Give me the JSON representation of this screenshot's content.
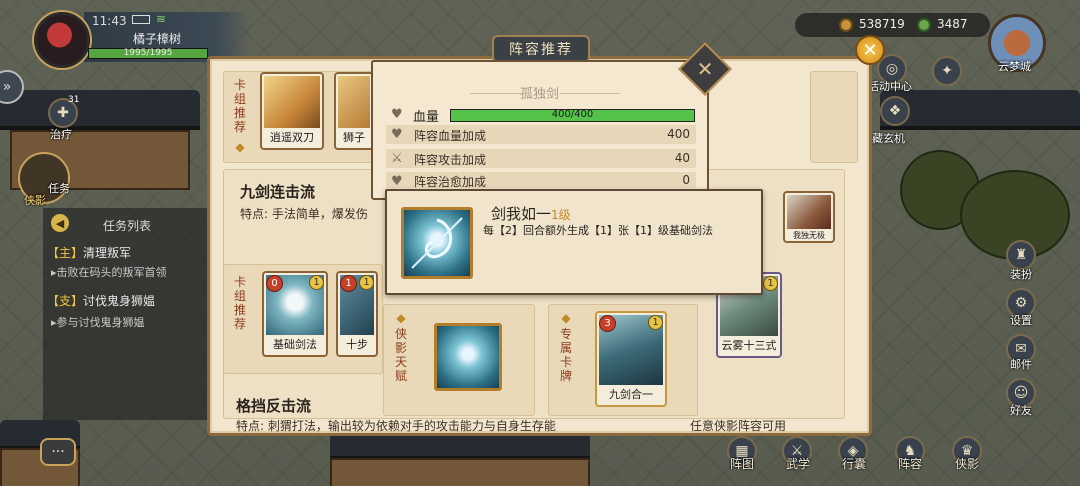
{
  "status": {
    "time": "11:43"
  },
  "player": {
    "name": "橘子樟树",
    "hp_text": "1995/1995",
    "hp_fraction": 1.0
  },
  "resources": {
    "silver": "538719",
    "jade": "3487"
  },
  "city": {
    "label": "云梦城"
  },
  "left_icons": {
    "heal_label": "治疗",
    "heal_count": "31",
    "task_label": "任务",
    "shadow_label": "侠影"
  },
  "tasks": {
    "header": "任务列表",
    "items": [
      {
        "tag": "【主】",
        "title": "清理叛军",
        "detail": "击败在码头的叛军首领"
      },
      {
        "tag": "【支】",
        "title": "讨伐鬼身狮媪",
        "detail": "参与讨伐鬼身狮媪"
      }
    ]
  },
  "right_menu": [
    "活动中心",
    "藏玄机",
    "装扮",
    "设置",
    "邮件",
    "好友"
  ],
  "bottom_menu": [
    "阵图",
    "武学",
    "行囊",
    "阵容",
    "侠影"
  ],
  "panel": {
    "title": "阵容推荐",
    "close_symbol": "✕",
    "section1": {
      "vertical": "卡组推荐",
      "cards": [
        {
          "name": "逍遥双刀"
        },
        {
          "name": "狮子"
        }
      ]
    },
    "section2": {
      "title": "九剑连击流",
      "desc": "特点: 手法简单，爆发伤",
      "vertical": "卡组推荐",
      "cards": [
        {
          "name": "基础剑法",
          "cost": "0",
          "level": "1"
        },
        {
          "name": "十步",
          "cost": "1",
          "level": "1"
        }
      ],
      "talent_vertical": "侠影天赋",
      "exclusive_vertical": "专属卡牌",
      "exclusive_card": {
        "name": "九剑合一",
        "cost": "3",
        "level": "1"
      },
      "right_cards": [
        {
          "name": "我独无极"
        },
        {
          "name": "云雾十三式",
          "level": "1"
        }
      ]
    },
    "section3": {
      "title": "格挡反击流",
      "desc": "特点: 刺猬打法，输出较为依赖对手的攻击能力与自身生存能",
      "extra": "任意侠影阵容可用"
    }
  },
  "stats": {
    "hero_name": "孤独剑",
    "close_symbol": "✕",
    "hp_label": "血量",
    "hp_text": "400/400",
    "hp_fraction": 1.0,
    "rows": [
      {
        "label": "阵容血量加成",
        "value": "400"
      },
      {
        "label": "阵容攻击加成",
        "value": "40"
      },
      {
        "label": "阵容治愈加成",
        "value": "0"
      }
    ]
  },
  "tooltip": {
    "name": "剑我如一",
    "level": "1级",
    "desc": "每【2】回合额外生成【1】张【1】级基础剑法"
  },
  "colors": {
    "hp_green": "#55c24a",
    "accent_gold": "#c08a26",
    "panel_bg": "#f2e6cf"
  }
}
